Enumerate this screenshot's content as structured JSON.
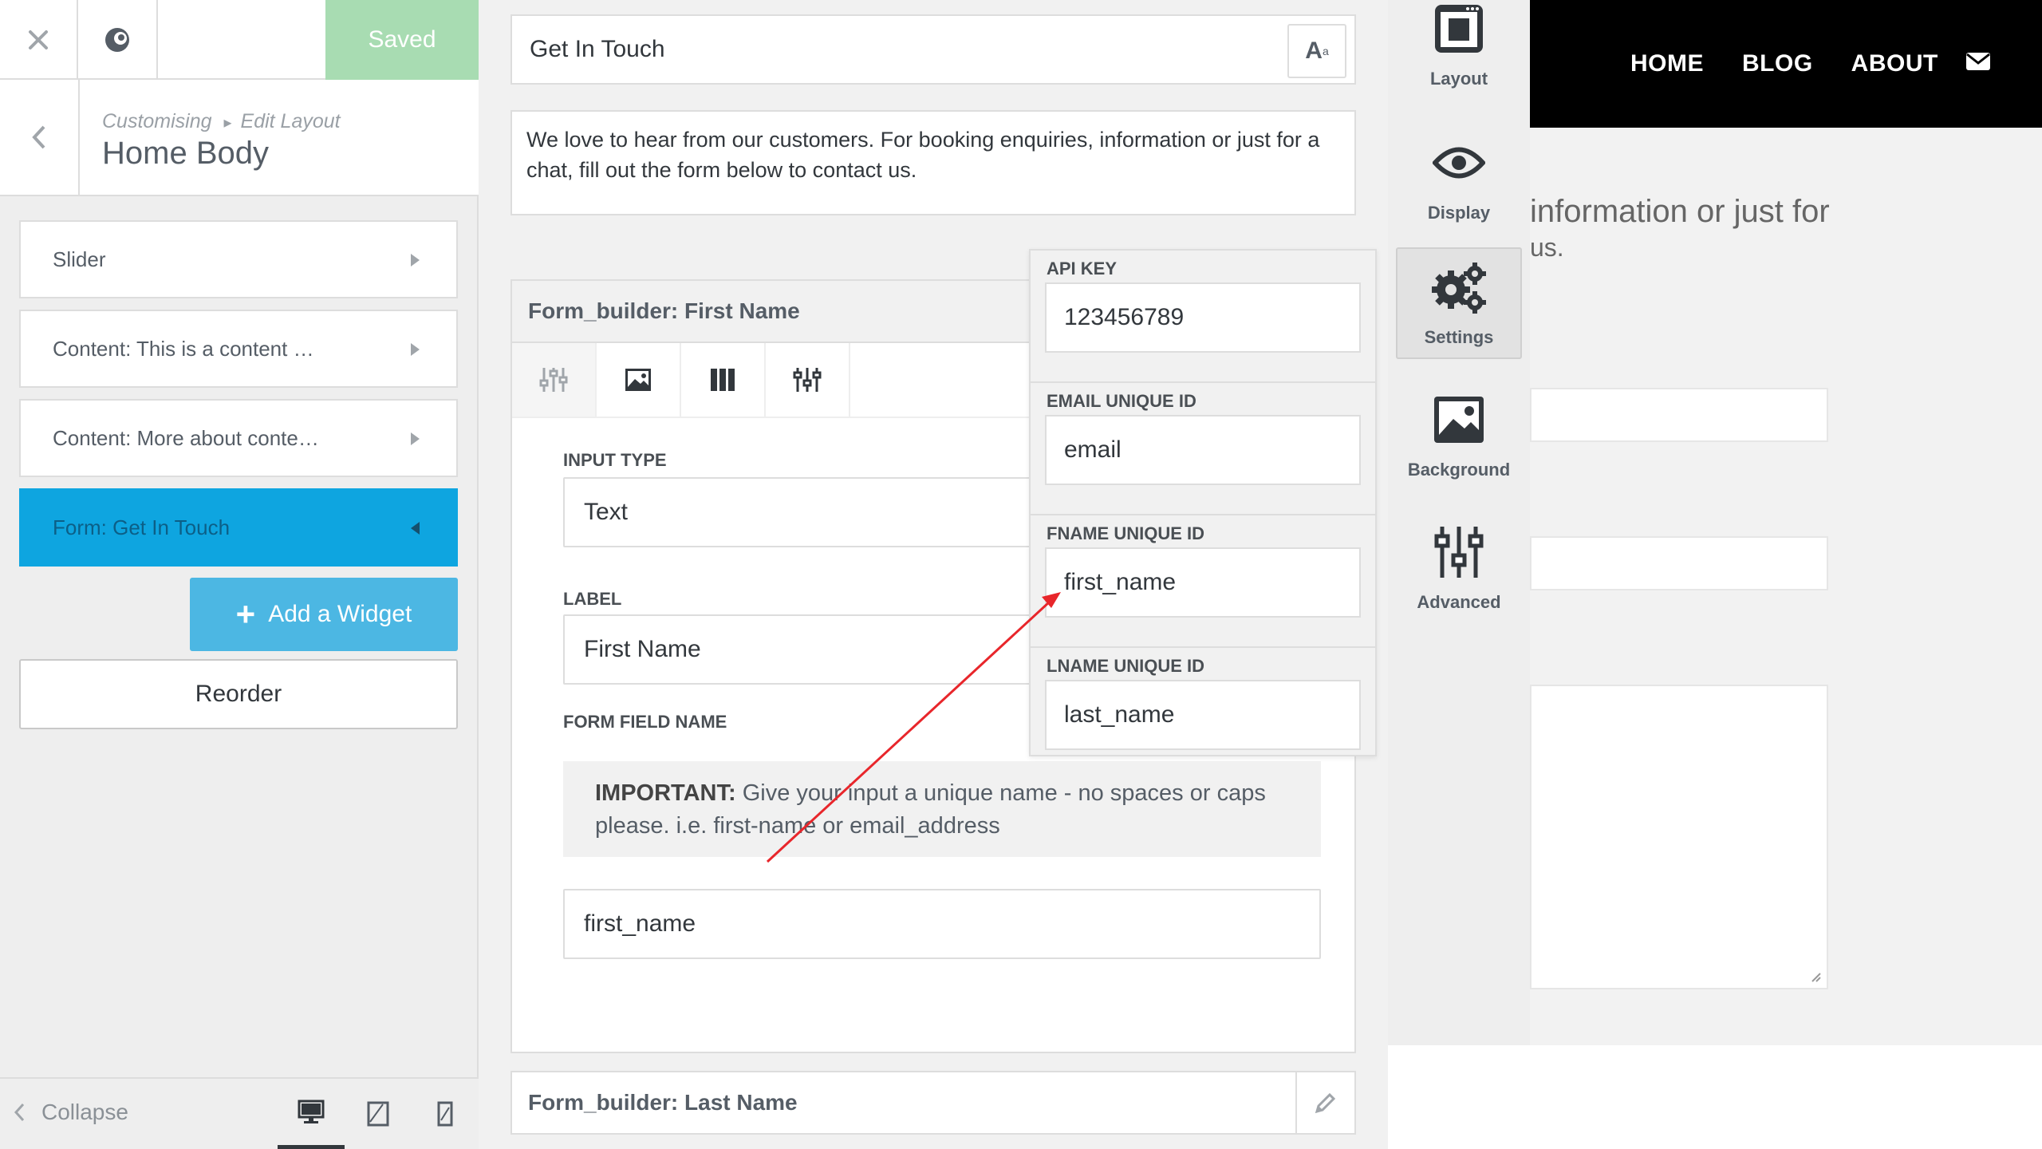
{
  "sidebar": {
    "close_icon": "close-icon",
    "saved_label": "Saved",
    "breadcrumb_root": "Customising",
    "breadcrumb_sep": "▸",
    "breadcrumb_current": "Edit Layout",
    "title": "Home Body",
    "items": [
      {
        "label": "Slider"
      },
      {
        "label": "Content: This is a content …"
      },
      {
        "label": "Content: More about conte…"
      },
      {
        "label": "Form: Get In Touch"
      }
    ],
    "add_widget_label": "Add a Widget",
    "reorder_label": "Reorder",
    "collapse_label": "Collapse"
  },
  "editor": {
    "title_value": "Get In Touch",
    "font_button": "A",
    "font_button_sup": "a",
    "intro_text": "We love to hear from our customers. For booking enquiries, information or just for a chat, fill out the form below to contact us.",
    "first_block": {
      "header": "Form_builder: First Name",
      "input_type_label": "INPUT TYPE",
      "input_type_value": "Text",
      "label_label": "LABEL",
      "label_value": "First Name",
      "field_name_label": "FORM FIELD NAME",
      "important_bold": "IMPORTANT:",
      "important_text": "Give your input a unique name - no spaces or caps please. i.e. first-name or email_address",
      "field_name_value": "first_name"
    },
    "last_block_header": "Form_builder: Last Name"
  },
  "settings_overlay": {
    "fields": [
      {
        "label": "API KEY",
        "value": "123456789"
      },
      {
        "label": "EMAIL UNIQUE ID",
        "value": "email"
      },
      {
        "label": "FNAME UNIQUE ID",
        "value": "first_name"
      },
      {
        "label": "LNAME UNIQUE ID",
        "value": "last_name"
      }
    ]
  },
  "side_tabs": [
    {
      "label": "Layout"
    },
    {
      "label": "Display"
    },
    {
      "label": "Settings"
    },
    {
      "label": "Background"
    },
    {
      "label": "Advanced"
    }
  ],
  "preview": {
    "nav": [
      "HOME",
      "BLOG",
      "ABOUT"
    ],
    "text_line1": "information or just for",
    "text_line2": "us."
  },
  "colors": {
    "active_item": "#0ea5e0",
    "add_widget": "#4cb7e3",
    "saved": "#a8dcb2",
    "arrow": "#e8262b"
  }
}
